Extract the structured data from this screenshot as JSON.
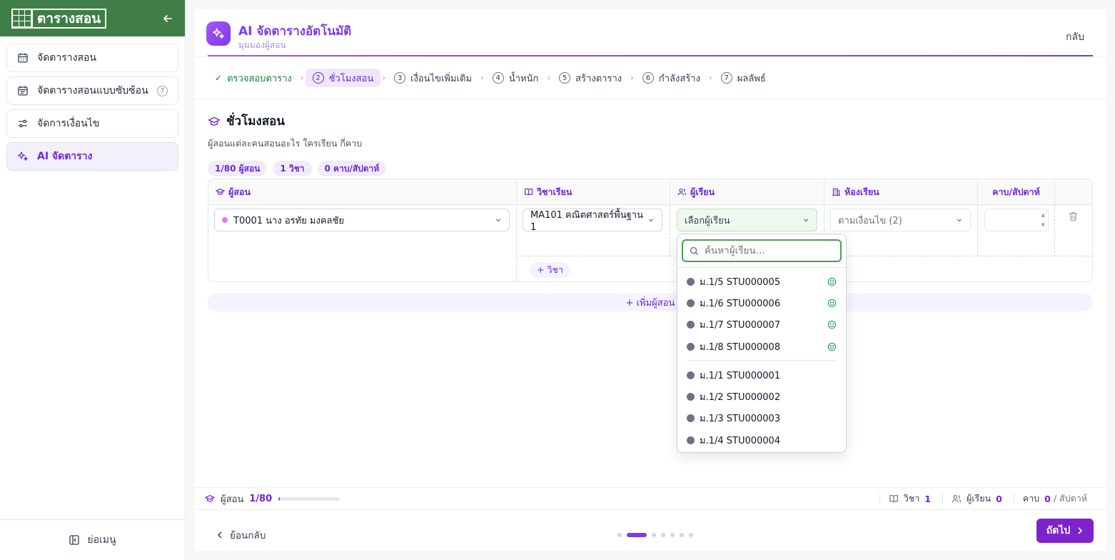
{
  "app": {
    "logo_text": "ตารางสอน"
  },
  "sidebar": {
    "items": [
      {
        "label": "จัดตารางสอน"
      },
      {
        "label": "จัดตารางสอนแบบซับซ้อน",
        "help": "?"
      },
      {
        "label": "จัดการเงื่อนไข"
      },
      {
        "label": "AI จัดตาราง"
      }
    ],
    "collapse_label": "ย่อเมนู"
  },
  "header": {
    "title": "AI จัดตารางอัตโนมัติ",
    "subtitle": "มุมมองผู้สอน",
    "back_label": "กลับ"
  },
  "steps": [
    {
      "label": "ตรวจสอบตาราง",
      "status": "done"
    },
    {
      "num": "2",
      "label": "ชั่วโมงสอน",
      "status": "active"
    },
    {
      "num": "3",
      "label": "เงื่อนไขเพิ่มเติม"
    },
    {
      "num": "4",
      "label": "น้ำหนัก"
    },
    {
      "num": "5",
      "label": "สร้างตาราง"
    },
    {
      "num": "6",
      "label": "กำลังสร้าง"
    },
    {
      "num": "7",
      "label": "ผลลัพธ์"
    }
  ],
  "section": {
    "title": "ชั่วโมงสอน",
    "description": "ผู้สอนแต่ละคนสอนอะไร ใครเรียน กี่คาบ",
    "chips": [
      "1/80 ผู้สอน",
      "1 วิชา",
      "0 คาบ/สัปดาห์"
    ]
  },
  "table": {
    "headers": [
      "ผู้สอน",
      "วิชาเรียน",
      "ผู้เรียน",
      "ห้องเรียน",
      "คาบ/สัปดาห์"
    ],
    "row": {
      "teacher": "T0001 นาง อรทัย มงคลชัย",
      "subject": "MA101 คณิตศาสตร์พื้นฐาน 1",
      "students_placeholder": "เลือกผู้เรียน",
      "room": "ตามเงื่อนไข (2)",
      "periods": ""
    },
    "add_subject_label": "+ วิชา",
    "add_teacher_label": "+ เพิ่มผู้สอน"
  },
  "dropdown": {
    "search_placeholder": "ค้นหาผู้เรียน...",
    "group_recommended": [
      "ม.1/5 STU000005",
      "ม.1/6 STU000006",
      "ม.1/7 STU000007",
      "ม.1/8 STU000008"
    ],
    "group_others": [
      "ม.1/1 STU000001",
      "ม.1/2 STU000002",
      "ม.1/3 STU000003",
      "ม.1/4 STU000004"
    ]
  },
  "status_bar": {
    "teacher_label": "ผู้สอน",
    "teacher_count": "1/80",
    "teacher_progress": 0.0125,
    "subject_label": "วิชา",
    "subject_count": "1",
    "student_label": "ผู้เรียน",
    "student_count": "0",
    "period_label": "คาบ",
    "period_count": "0",
    "period_unit": "/ สัปดาห์"
  },
  "footer": {
    "prev_label": "ย้อนกลับ",
    "next_label": "ถัดไป",
    "page_dots": 7,
    "active_dot": 2
  },
  "colors": {
    "accent": "#7c3aed",
    "brand_green": "#3f7f47",
    "success": "#22a04a"
  }
}
